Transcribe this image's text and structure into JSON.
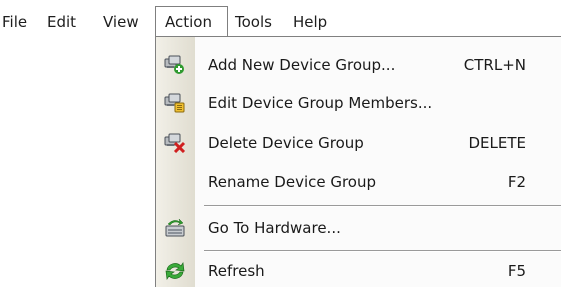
{
  "menubar": {
    "items": [
      {
        "label": "File"
      },
      {
        "label": "Edit"
      },
      {
        "label": "View"
      },
      {
        "label": "Action"
      },
      {
        "label": "Tools"
      },
      {
        "label": "Help"
      }
    ]
  },
  "action_menu": {
    "items": [
      {
        "label": "Add New Device Group...",
        "shortcut": "CTRL+N",
        "icon": "add-device-group-icon"
      },
      {
        "label": "Edit Device Group Members...",
        "shortcut": "",
        "icon": "edit-device-group-icon"
      },
      {
        "label": "Delete Device Group",
        "shortcut": "DELETE",
        "icon": "delete-device-group-icon"
      },
      {
        "label": "Rename Device Group",
        "shortcut": "F2",
        "icon": ""
      },
      {
        "label": "Go To Hardware...",
        "shortcut": "",
        "icon": "hardware-icon"
      },
      {
        "label": "Refresh",
        "shortcut": "F5",
        "icon": "refresh-icon"
      }
    ]
  },
  "colors": {
    "menu_background": "#fbfbfb",
    "icon_column": "#e8e5da",
    "border": "#808080"
  }
}
